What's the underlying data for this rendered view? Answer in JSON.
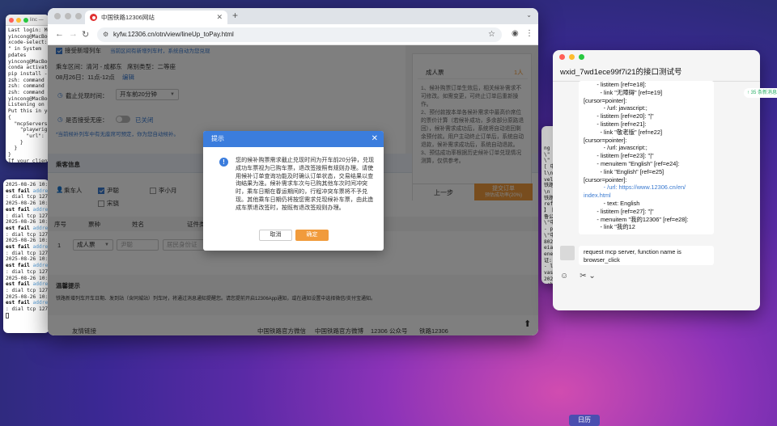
{
  "term1": {
    "title": "linc — ",
    "lines": [
      "Last login: Mo",
      "yincong@MacBoo",
      "xcode-select:",
      "\" in System",
      "pdates",
      "yincong@MacBoo",
      "conda activate",
      "pip install -r",
      "zsh: command n",
      "zsh: command n",
      "zsh: command n",
      "yincong@MacBoo",
      "Listening on h",
      "Put this in yo",
      "{",
      "  \"mcpServers\"",
      "    \"playwrigh",
      "      \"url\": \"",
      "    }",
      "  }",
      "}",
      "If your client"
    ]
  },
  "term2": {
    "lines": [
      [
        "2025-08-26 10:",
        "",
        ""
      ],
      [
        "",
        "est fail",
        " addre"
      ],
      [
        ": dial tcp 127.",
        "",
        ""
      ],
      [
        "2025-08-26 10:",
        "",
        ""
      ],
      [
        "",
        "est fail",
        " addre"
      ],
      [
        ": dial tcp 127.",
        "",
        ""
      ],
      [
        "2025-08-26 10:",
        "",
        ""
      ],
      [
        "",
        "est fail",
        " addre"
      ],
      [
        ": dial tcp 127.",
        "",
        ""
      ],
      [
        "2025-08-26 10:",
        "",
        ""
      ],
      [
        "",
        "est fail",
        " addre"
      ],
      [
        ": dial tcp 127.",
        "",
        ""
      ],
      [
        "2025-08-26 10:",
        "",
        ""
      ],
      [
        "",
        "est fail",
        " addre"
      ],
      [
        ": dial tcp 127.",
        "",
        ""
      ],
      [
        "2025-08-26 10:",
        "",
        ""
      ],
      [
        "",
        "est fail",
        " addre"
      ],
      [
        ": dial tcp 127.",
        "",
        ""
      ],
      [
        "2025-08-26 10:",
        "",
        ""
      ],
      [
        "",
        "est fail",
        " addre"
      ],
      [
        ": dial tcp 127.",
        "",
        ""
      ]
    ]
  },
  "term3": {
    "lines": [
      "ng \\",
      "\\\" 中",
      "\\\" [",
      "[ 中",
      "l\\n",
      "vel=",
      "铁路",
      "\\n",
      "铁路",
      "ref=",
      "】 版",
      "鲁公",
      "\\\"中",
      "- pa",
      "\\\"中",
      "8020",
      "eian",
      "ener",
      "证:",
      "- li",
      "vasc",
      "2025",
      "-cha"
    ]
  },
  "browser": {
    "tab_title": "中国铁路12306网站",
    "url": "kyfw.12306.cn/otn/view/lineUp_toPay.html"
  },
  "page": {
    "top_cut": "当前区间有新增列车时，系统自动为您兑现",
    "new_train_label": "接受新增列车",
    "route": "乘车区间：清河 - 成都东",
    "seat_type": "席别类型：二等座",
    "date_time": "08月26日：11点-12点",
    "edit_link": "编辑",
    "deadline_label": "截止兑现时间：",
    "deadline_value": "开车前20分钟",
    "accept_noseat_label": "是否接受无座：",
    "closed_label": "已关闭",
    "hint": "*当前候补列车中有无座席可预定，你为您自动候补。",
    "passenger_title": "乘客信息",
    "passenger_label": "乘车人",
    "passengers": [
      "尹聪",
      "李小月",
      "宋骁"
    ],
    "table_headers": [
      "序号",
      "票种",
      "姓名",
      "证件类"
    ],
    "row": {
      "index": "1",
      "ticket_type": "成人票",
      "name_ph": "尹聪",
      "id_type_ph": "居民身份证"
    },
    "warm_title": "温馨提示",
    "warm_text": "铁路新增列车开车日期、发到站（含同城站）列车时，将通过消息通知提醒您。请您提前开启12306App通知，或在通知设置中选择微信/支付宝通知。",
    "footer_links": [
      "友情链接",
      "中国铁路官方微信",
      "中国铁路官方微博",
      "12306 公众号",
      "铁路12306"
    ],
    "side": {
      "ticket_label": "成人票",
      "count": "1人",
      "notes": "1、候补购票订单生效后，相关候补需求不可修改。如需变更，可终止订单后重新操作。\n2、预付款按本单各候补需求中最高价席位的票价计算（若候补成功，多余部分原路退回），候补需求成功后，系统将自动退回剩余预付款。用户主动终止订单后，系统自动退款，候补需求成功后，系统自动退款。\n3、预估成功率根据历史候补订单兑现情况测算，仅供参考。",
      "prev_btn": "上一步",
      "submit_btn": "提交订单",
      "submit_sub": "预估成功率(20%)"
    }
  },
  "modal": {
    "title": "提示",
    "message": "您的候补购票需求截止兑现时间为开车前20分钟，兑现成功车票视为已购车票，退改签按照有规则办理。请使用候补订单查询功能及时确认订单状态，交易结果以查询结果为准。候补需求车次与已购其他车次时间冲突时，乘车日期在春运期间的，行程冲突车票将不予兑现。其他乘车日期仍将按您需求兑现候补车票，由此造成车票退改签时，按既有退改签规则办理。",
    "cancel": "取消",
    "confirm": "确定"
  },
  "chat": {
    "title": "wxid_7wd1ece99f7i21的接口测试号",
    "new_msg_badge": "↑ 35 条新消息",
    "bubble1": [
      "        - listitem [ref=e18]:",
      "          - link \"无障碍\" [ref=e19]",
      "[cursor=pointer]:",
      "            - /url: javascript:;",
      "        - listitem [ref=e20]: \"|\"",
      "        - listitem [ref=e21]:",
      "          - link \"敬老版\" [ref=e22]",
      "[cursor=pointer]:",
      "            - /url: javascript:;",
      "        - listitem [ref=e23]: \"|\"",
      "        - menuitem \"English\" [ref=e24]:",
      "          - link \"English\" [ref=e25]",
      "[cursor=pointer]:",
      "            - /url: https://www.12306.cn/en/",
      "index.html",
      "            - text: English",
      "        - listitem [ref=e27]: \"|\"",
      "        - menuitem \"我的12306\" [ref=e28]:",
      "          - link \"我的12"
    ],
    "bubble2": [
      "request mcp server, function name is",
      "browser_click"
    ]
  },
  "dock": {
    "calendar": "日历"
  },
  "colors": {
    "primary": "#3b7ddd",
    "orange": "#f19b3c",
    "link": "#3a7ad0"
  }
}
